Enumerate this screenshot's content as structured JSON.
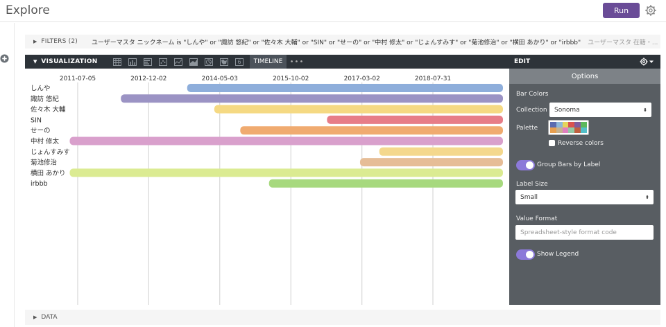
{
  "app": {
    "title": "Explore",
    "run_label": "Run"
  },
  "filters": {
    "label": "FILTERS (2)",
    "text": "ユーザーマスタ ニックネーム is \"しんや\" or \"諏訪 悠紀\" or \"佐々木 大輔\" or \"SIN\" or \"せーの\" or \"中村 修太\" or \"じょんすみす\" or \"菊池修治\" or \"横田 あかり\" or \"irbbb\"",
    "text2": "ユーザーマスタ 在籍・..."
  },
  "visualization": {
    "label": "VISUALIZATION",
    "tools": [
      "table-icon",
      "bar-chart-icon",
      "column-icon",
      "scatter-icon",
      "line-icon",
      "area-icon",
      "pie-icon",
      "map-icon",
      "single-value-icon"
    ],
    "single_value_glyph": "6",
    "timeline_label": "TIMELINE",
    "more_glyph": "•••"
  },
  "edit": {
    "label": "EDIT",
    "options_tab": "Options",
    "bar_colors_label": "Bar Colors",
    "collection_label": "Collection",
    "collection_value": "Sonoma",
    "palette_label": "Palette",
    "palette_colors": [
      "#5b6bb0",
      "#8fb7d9",
      "#e5d45b",
      "#d9534f",
      "#7f5c9e",
      "#5cb85c",
      "#e89f4f",
      "#c8b28e",
      "#e07fbf",
      "#93c9a4",
      "#c06040",
      "#53c0c9"
    ],
    "reverse_label": "Reverse colors",
    "group_bars_label": "Group Bars by Label",
    "label_size_label": "Label Size",
    "label_size_value": "Small",
    "value_format_label": "Value Format",
    "value_format_placeholder": "Spreadsheet-style format code",
    "show_legend_label": "Show Legend",
    "toggle_color": "#8c79d9"
  },
  "data_section": {
    "label": "DATA"
  },
  "chart_data": {
    "type": "timeline",
    "ticks": [
      "2011-07-05",
      "2012-12-02",
      "2014-05-03",
      "2015-10-02",
      "2017-03-02",
      "2018-07-31"
    ],
    "x_start": "2011-07-05",
    "x_end": "2018-07-31",
    "rows": [
      {
        "label": "しんや",
        "start": "2013-09-08",
        "end": "2020-06-30",
        "color": "#8eaedb"
      },
      {
        "label": "諏訪 悠紀",
        "start": "2012-05-14",
        "end": "2020-06-30",
        "color": "#9b93c4"
      },
      {
        "label": "佐々木 大輔",
        "start": "2014-03-24",
        "end": "2020-06-30",
        "color": "#f5d983"
      },
      {
        "label": "SIN",
        "start": "2016-06-21",
        "end": "2020-06-30",
        "color": "#e77d88"
      },
      {
        "label": "せーの",
        "start": "2014-09-29",
        "end": "2020-06-30",
        "color": "#f0ab70"
      },
      {
        "label": "中村 修太",
        "start": "2011-05-08",
        "end": "2020-06-30",
        "color": "#d9a0cc"
      },
      {
        "label": "じょんすみす",
        "start": "2017-07-06",
        "end": "2020-06-30",
        "color": "#f4d88d"
      },
      {
        "label": "菊池修治",
        "start": "2017-02-16",
        "end": "2020-06-30",
        "color": "#e6bd97"
      },
      {
        "label": "横田 あかり",
        "start": "2011-05-08",
        "end": "2020-06-30",
        "color": "#dbeb92"
      },
      {
        "label": "irbbb",
        "start": "2015-04-26",
        "end": "2020-06-30",
        "color": "#a7d97e"
      }
    ]
  }
}
